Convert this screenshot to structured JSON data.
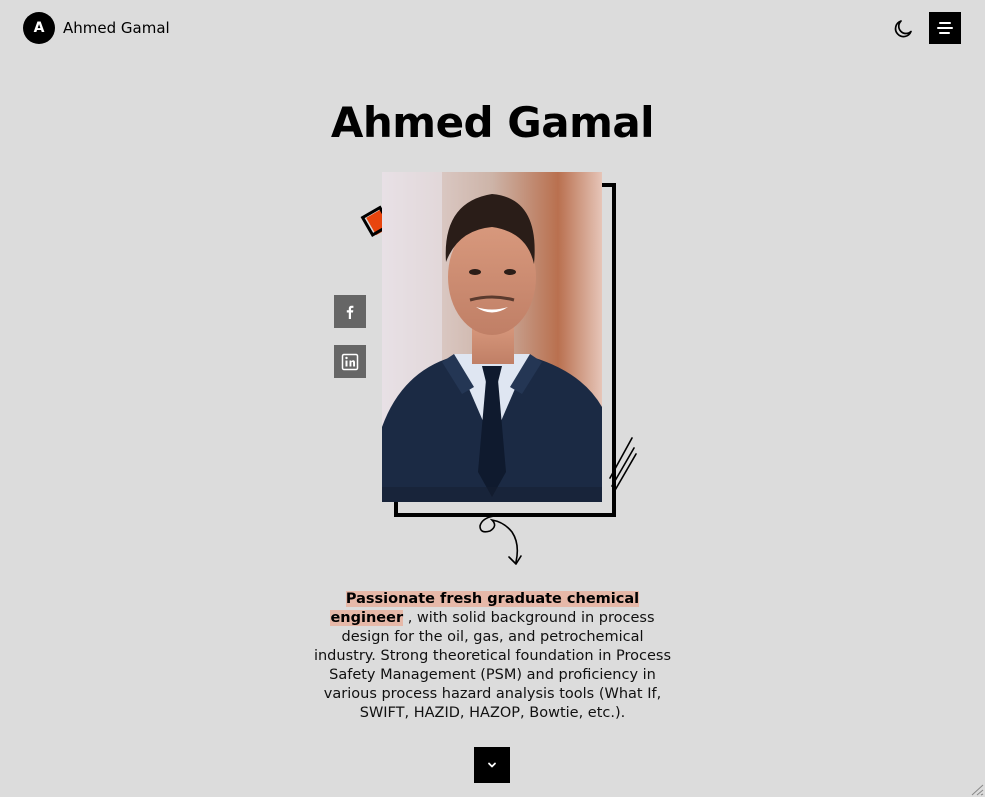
{
  "header": {
    "logo_letter": "A",
    "logo_name": "Ahmed Gamal",
    "theme_toggle_icon": "moon-icon",
    "menu_icon": "hamburger-menu-icon"
  },
  "hero": {
    "title": "Ahmed Gamal",
    "photo_alt": "Ahmed Gamal",
    "social": [
      {
        "name": "facebook",
        "icon": "facebook-icon"
      },
      {
        "name": "linkedin",
        "icon": "linkedin-icon"
      }
    ],
    "bio_highlight": "Passionate fresh graduate chemical engineer",
    "bio_rest": " , with solid background in process design for the oil, gas, and petrochemical industry. Strong theoretical foundation in Process Safety Management (PSM) and proficiency in various process hazard analysis tools (What If, SWIFT, HAZID, HAZOP, Bowtie, etc.).",
    "scroll_icon": "chevron-down-icon"
  },
  "colors": {
    "background": "#dcdcdc",
    "accent": "#e8450e",
    "highlight": "#e6b8a8",
    "social_bg": "#666666"
  }
}
